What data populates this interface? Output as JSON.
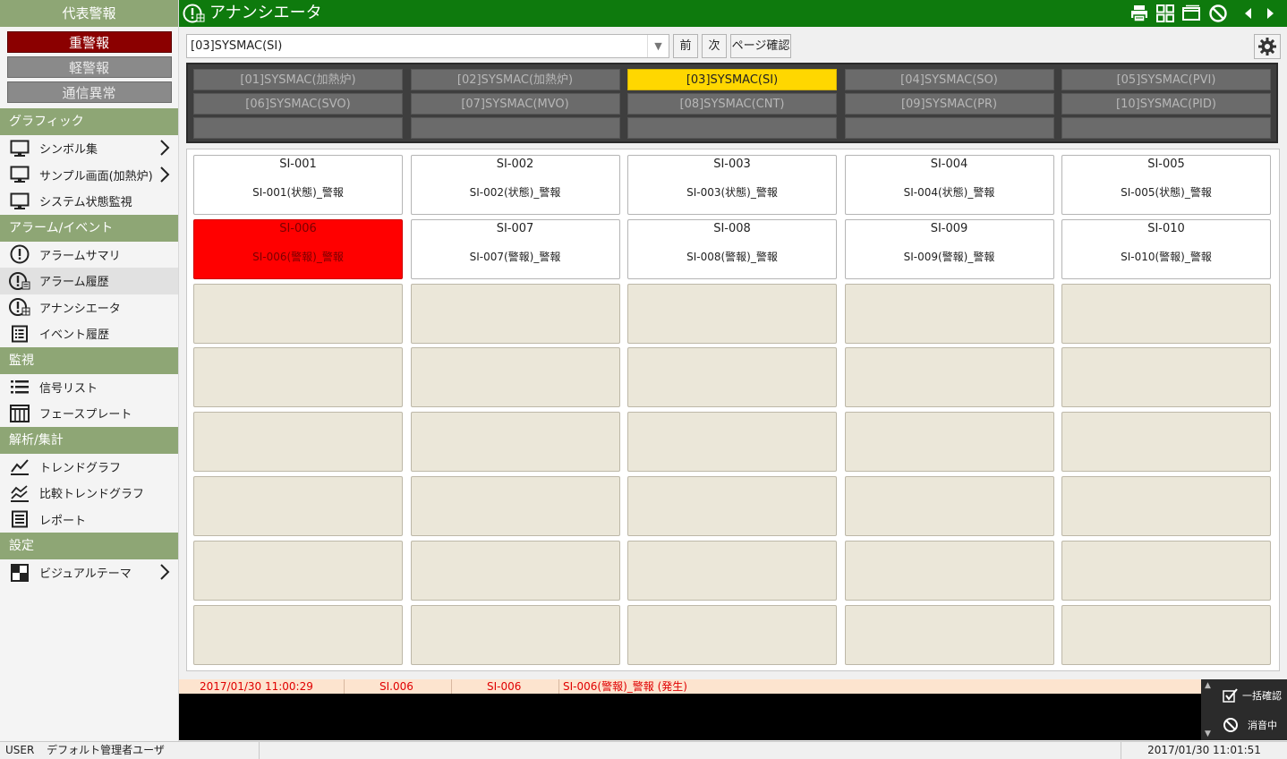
{
  "sidebar": {
    "rep_alarm_title": "代表警報",
    "alarm_buttons": {
      "heavy": "重警報",
      "light": "軽警報",
      "comm": "通信異常"
    },
    "sections": {
      "graphic": "グラフィック",
      "alarm_event": "アラーム/イベント",
      "monitor": "監視",
      "analysis": "解析/集計",
      "settings": "設定"
    },
    "items": {
      "symbols": "シンボル集",
      "sample": "サンプル画面(加熱炉)",
      "system_status": "システム状態監視",
      "alarm_summary": "アラームサマリ",
      "alarm_history": "アラーム履歴",
      "annunciator": "アナンシエータ",
      "event_history": "イベント履歴",
      "signal_list": "信号リスト",
      "faceplate": "フェースプレート",
      "trend_graph": "トレンドグラフ",
      "compare_trend": "比較トレンドグラフ",
      "report": "レポート",
      "visual_theme": "ビジュアルテーマ"
    },
    "icons": {
      "symbols": "monitor-icon",
      "sample": "monitor-icon",
      "system_status": "monitor-icon",
      "alarm_summary": "alert-circle-icon",
      "alarm_history": "alert-history-icon",
      "annunciator": "annunciator-icon",
      "event_history": "list-box-icon",
      "signal_list": "bulleted-list-icon",
      "faceplate": "faceplate-grid-icon",
      "trend_graph": "trend-line-icon",
      "compare_trend": "compare-trend-icon",
      "report": "report-icon",
      "visual_theme": "checker-icon"
    }
  },
  "titlebar": {
    "title": "アナンシエータ",
    "icons": [
      "print-icon",
      "grid-layout-icon",
      "window-icon",
      "mute-icon",
      "prev-arrow-icon",
      "next-arrow-icon"
    ]
  },
  "toolbar": {
    "page_select": "[03]SYSMAC(SI)",
    "prev": "前",
    "next": "次",
    "page_confirm": "ページ確認"
  },
  "page_tabs": [
    "[01]SYSMAC(加熱炉)",
    "[02]SYSMAC(加熱炉)",
    "[03]SYSMAC(SI)",
    "[04]SYSMAC(SO)",
    "[05]SYSMAC(PVI)",
    "[06]SYSMAC(SVO)",
    "[07]SYSMAC(MVO)",
    "[08]SYSMAC(CNT)",
    "[09]SYSMAC(PR)",
    "[10]SYSMAC(PID)",
    "",
    "",
    "",
    "",
    ""
  ],
  "active_tab_index": 2,
  "cells": [
    {
      "name": "SI-001",
      "desc": "SI-001(状態)_警報",
      "state": "normal"
    },
    {
      "name": "SI-002",
      "desc": "SI-002(状態)_警報",
      "state": "normal"
    },
    {
      "name": "SI-003",
      "desc": "SI-003(状態)_警報",
      "state": "normal"
    },
    {
      "name": "SI-004",
      "desc": "SI-004(状態)_警報",
      "state": "normal"
    },
    {
      "name": "SI-005",
      "desc": "SI-005(状態)_警報",
      "state": "normal"
    },
    {
      "name": "SI-006",
      "desc": "SI-006(警報)_警報",
      "state": "alarm"
    },
    {
      "name": "SI-007",
      "desc": "SI-007(警報)_警報",
      "state": "normal"
    },
    {
      "name": "SI-008",
      "desc": "SI-008(警報)_警報",
      "state": "normal"
    },
    {
      "name": "SI-009",
      "desc": "SI-009(警報)_警報",
      "state": "normal"
    },
    {
      "name": "SI-010",
      "desc": "SI-010(警報)_警報",
      "state": "normal"
    }
  ],
  "alarm_line": {
    "time": "2017/01/30 11:00:29",
    "group": "SI.006",
    "tag": "SI-006",
    "message": "SI-006(警報)_警報 (発生)"
  },
  "alarm_side": {
    "ack_all": "一括確認",
    "silence": "消音中"
  },
  "statusbar": {
    "user_label": "USER",
    "user_name": "デフォルト管理者ユーザ",
    "datetime": "2017/01/30 11:01:51"
  },
  "colors": {
    "titlebar": "#0e7a0d",
    "section_header": "#8ea675",
    "heavy_alarm": "#8b0000",
    "active_tab": "#ffd700",
    "alarm_cell": "#ff0000",
    "empty_cell": "#ebe7d9"
  }
}
